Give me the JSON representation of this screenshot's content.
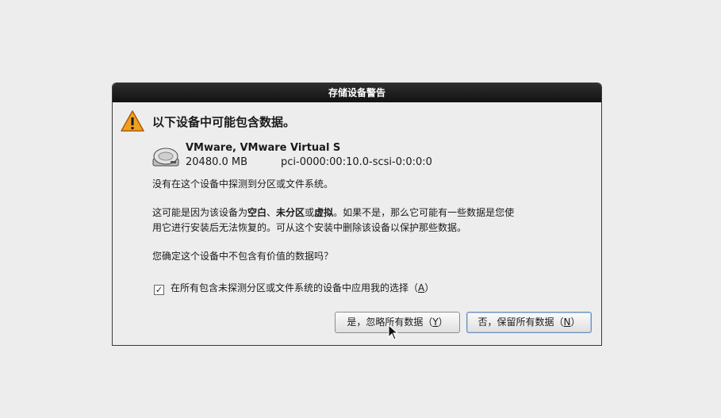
{
  "dialog": {
    "title": "存储设备警告",
    "heading": "以下设备中可能包含数据。",
    "device": {
      "name": "VMware, VMware Virtual S",
      "size": "20480.0 MB",
      "path": "pci-0000:00:10.0-scsi-0:0:0:0"
    },
    "msg1": "没有在这个设备中探测到分区或文件系统。",
    "msg2": {
      "p1": "这可能是因为该设备为",
      "b1": "空白",
      "sep1": "、",
      "b2": "未分区",
      "p2": "或",
      "b3": "虚拟",
      "p3": "。如果不是，那么它可能有一些数据是您使",
      "line2": "用它进行安装后无法恢复的。可从这个安装中删除该设备以保护那些数据。"
    },
    "msg3": "您确定这个设备中不包含有价值的数据吗？",
    "checkbox": {
      "checked": true,
      "mark": "☑",
      "label_prefix": "在所有包含未探测分区或文件系统的设备中应用我的选择（",
      "mnemonic": "A",
      "label_suffix": "）"
    },
    "buttons": {
      "yes": {
        "prefix": "是，忽略所有数据（",
        "mnemonic": "Y",
        "suffix": "）"
      },
      "no": {
        "prefix": "否，保留所有数据（",
        "mnemonic": "N",
        "suffix": "）"
      }
    },
    "icons": {
      "warning": "warning-icon",
      "disk": "hard-disk-icon",
      "cursor": "mouse-pointer-icon"
    }
  }
}
